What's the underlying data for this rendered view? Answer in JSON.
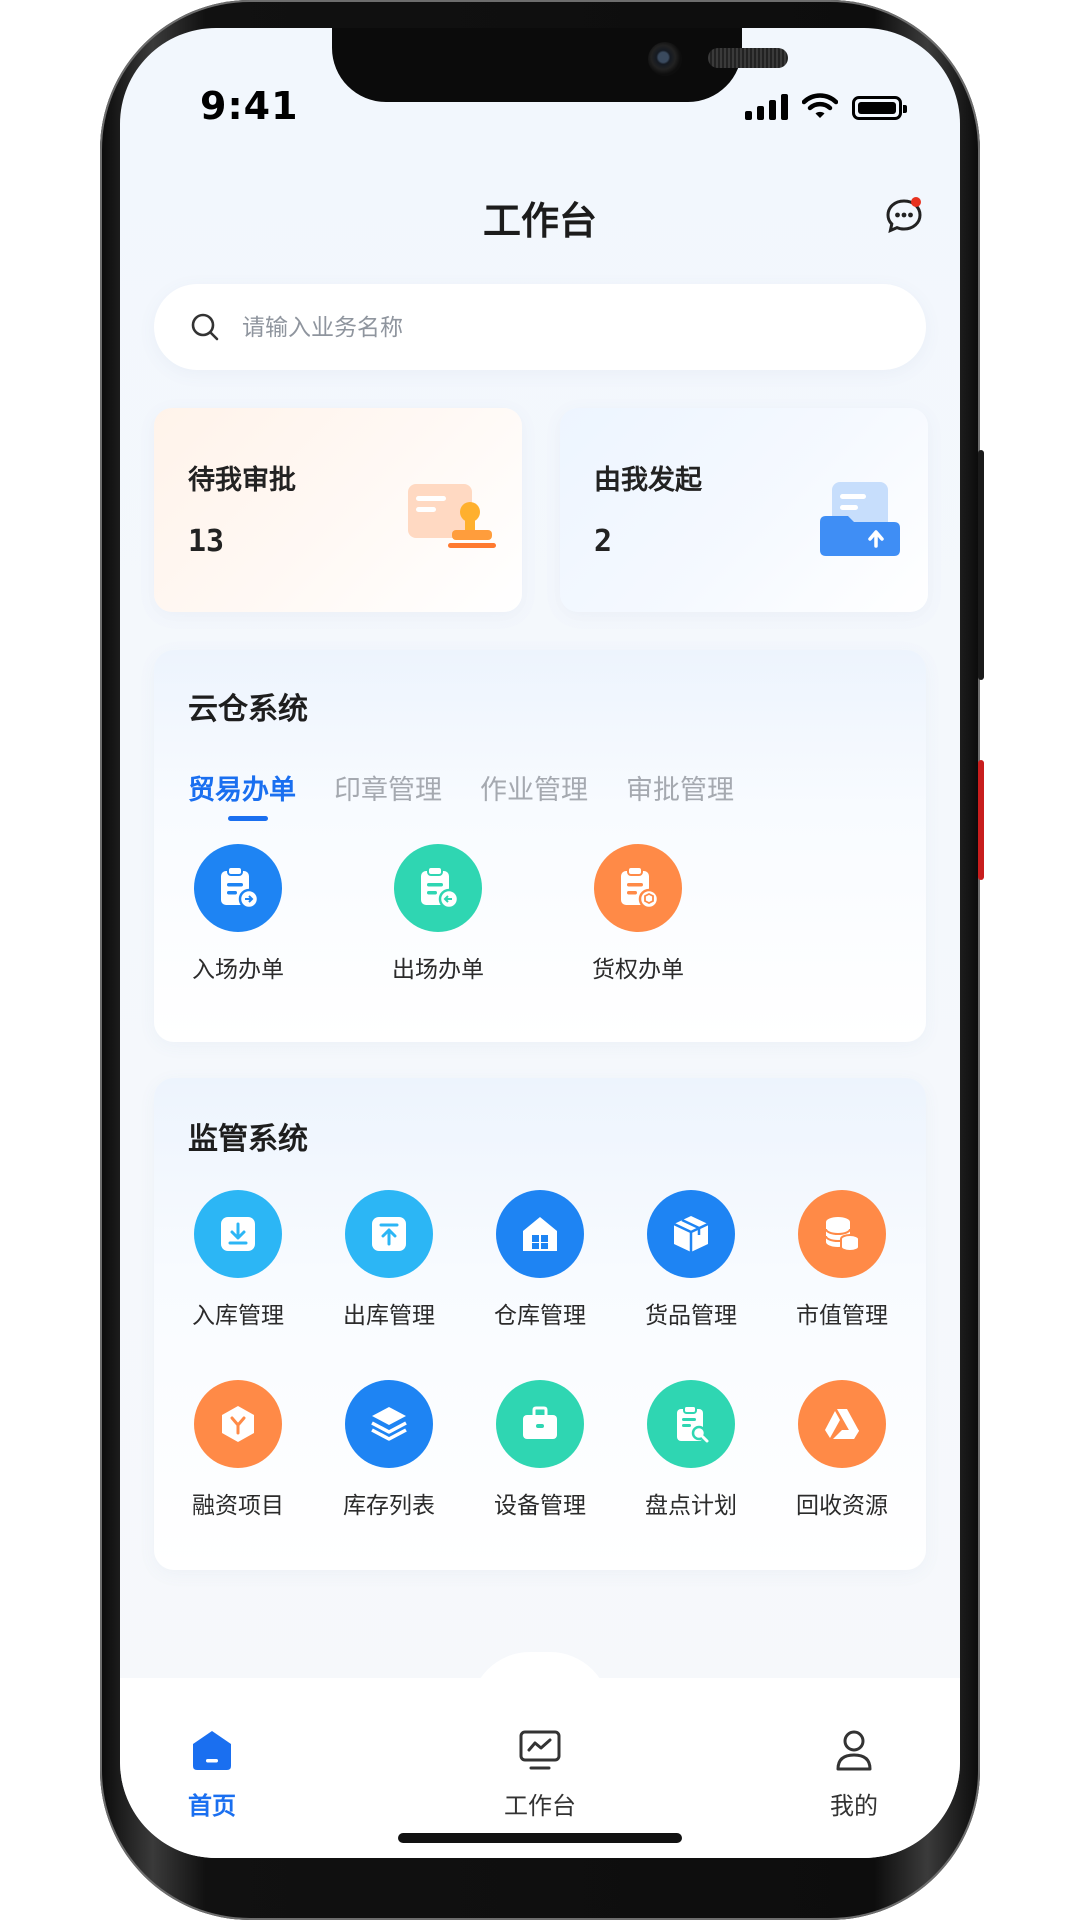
{
  "status_bar": {
    "time": "9:41"
  },
  "header": {
    "title": "工作台"
  },
  "search": {
    "placeholder": "请输入业务名称"
  },
  "summary_cards": [
    {
      "title": "待我审批",
      "count": "13"
    },
    {
      "title": "由我发起",
      "count": "2"
    }
  ],
  "cloud_warehouse": {
    "title": "云仓系统",
    "tabs": [
      "贸易办单",
      "印章管理",
      "作业管理",
      "审批管理"
    ],
    "active_tab": "贸易办单",
    "items": [
      {
        "label": "入场办单",
        "icon": "clipboard-entry-icon",
        "color": "#1e84f3"
      },
      {
        "label": "出场办单",
        "icon": "clipboard-exit-icon",
        "color": "#2fd6b2"
      },
      {
        "label": "货权办单",
        "icon": "clipboard-goods-icon",
        "color": "#ff8a47"
      }
    ]
  },
  "supervision": {
    "title": "监管系统",
    "items": [
      {
        "label": "入库管理",
        "icon": "inbound-icon",
        "color": "#2cb6f5"
      },
      {
        "label": "出库管理",
        "icon": "outbound-icon",
        "color": "#2cb6f5"
      },
      {
        "label": "仓库管理",
        "icon": "warehouse-icon",
        "color": "#1e84f3"
      },
      {
        "label": "货品管理",
        "icon": "package-icon",
        "color": "#1e84f3"
      },
      {
        "label": "市值管理",
        "icon": "coins-icon",
        "color": "#ff8a47"
      },
      {
        "label": "融资项目",
        "icon": "finance-icon",
        "color": "#ff8a47"
      },
      {
        "label": "库存列表",
        "icon": "layers-icon",
        "color": "#1e84f3"
      },
      {
        "label": "设备管理",
        "icon": "toolbox-icon",
        "color": "#2fd6b2"
      },
      {
        "label": "盘点计划",
        "icon": "inventory-check-icon",
        "color": "#2fd6b2"
      },
      {
        "label": "回收资源",
        "icon": "recycle-icon",
        "color": "#ff8a47"
      }
    ]
  },
  "tab_bar": {
    "items": [
      {
        "label": "首页",
        "icon": "home-icon"
      },
      {
        "label": "工作台",
        "icon": "workbench-icon"
      },
      {
        "label": "我的",
        "icon": "user-icon"
      }
    ],
    "active": "首页"
  }
}
